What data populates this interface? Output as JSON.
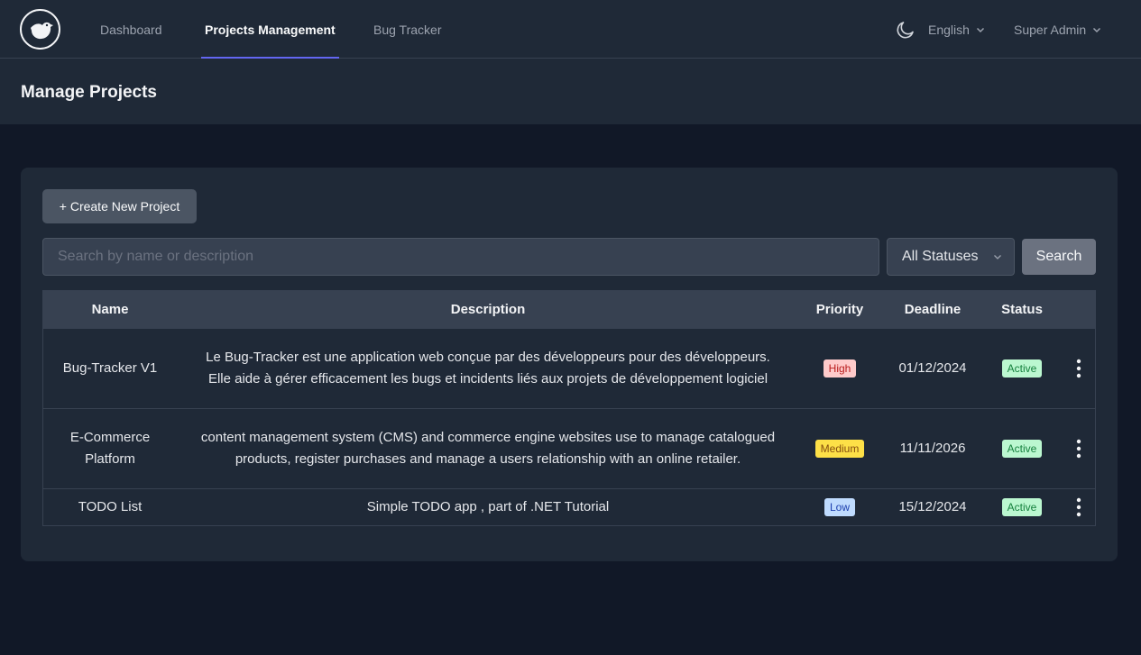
{
  "nav": {
    "links": [
      {
        "label": "Dashboard"
      },
      {
        "label": "Projects Management"
      },
      {
        "label": "Bug Tracker"
      }
    ],
    "language": "English",
    "user": "Super Admin",
    "accent_color": "#6366f1"
  },
  "header": {
    "title": "Manage Projects"
  },
  "toolbar": {
    "create_label": "+ Create New Project",
    "search_placeholder": "Search by name or description",
    "search_value": "",
    "status_selected": "All Statuses",
    "search_label": "Search"
  },
  "table": {
    "columns": [
      "Name",
      "Description",
      "Priority",
      "Deadline",
      "Status"
    ],
    "rows": [
      {
        "name": "Bug-Tracker V1",
        "description": "Le Bug-Tracker est une application web conçue par des développeurs pour des développeurs. Elle aide à gérer efficacement les bugs et incidents liés aux projets de développement logiciel",
        "priority": "High",
        "deadline": "01/12/2024",
        "status": "Active"
      },
      {
        "name": "E-Commerce Platform",
        "description": "content management system (CMS) and commerce engine websites use to manage catalogued products, register purchases and manage a users relationship with an online retailer.",
        "priority": "Medium",
        "deadline": "11/11/2026",
        "status": "Active"
      },
      {
        "name": "TODO List",
        "description": "Simple TODO app , part of .NET Tutorial",
        "priority": "Low",
        "deadline": "15/12/2024",
        "status": "Active"
      }
    ]
  },
  "icons": {
    "logo": "bird-logo-icon",
    "theme": "moon-icon",
    "dropdown": "chevron-down-icon",
    "row_actions": "kebab-menu-icon"
  }
}
